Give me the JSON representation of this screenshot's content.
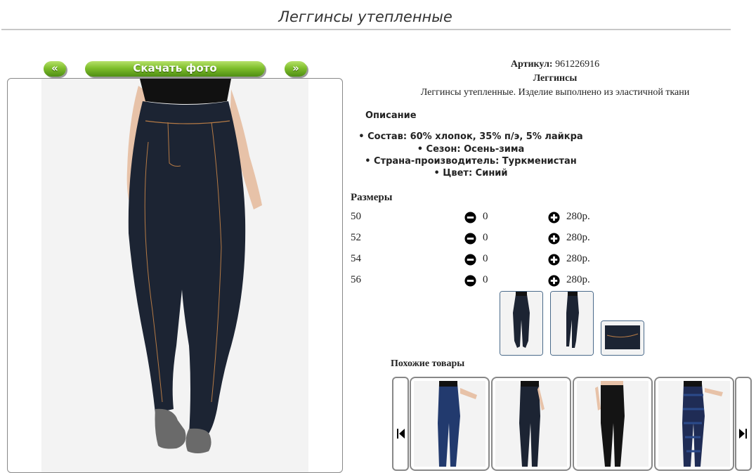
{
  "product": {
    "title": "Леггинсы утепленные",
    "article_label": "Артикул:",
    "article_value": "961226916",
    "name": "Леггинсы",
    "short_desc": "Леггинсы утепленные. Изделие выполнено из эластичной ткани"
  },
  "nav": {
    "prev_label": "«",
    "download_label": "Скачать фото",
    "next_label": "»"
  },
  "description": {
    "heading": "Описание",
    "items": [
      "• Состав: 60% хлопок, 35% п/э, 5% лайкра",
      "• Сезон: Осень-зима",
      "• Страна-производитель: Туркменистан",
      "• Цвет: Синий"
    ]
  },
  "sizes": {
    "heading": "Размеры",
    "rows": [
      {
        "size": "50",
        "qty": "0",
        "price": "280р."
      },
      {
        "size": "52",
        "qty": "0",
        "price": "280р."
      },
      {
        "size": "54",
        "qty": "0",
        "price": "280р."
      },
      {
        "size": "56",
        "qty": "0",
        "price": "280р."
      }
    ]
  },
  "similar": {
    "heading": "Похожие товары"
  },
  "colors": {
    "leggings": "#1c2433",
    "top": "#111111",
    "skin": "#e7c2a8",
    "shoe": "#6a6a6a",
    "stitch": "#b57a45",
    "accent_green": "#6fb22a"
  },
  "icons": {
    "minus": "minus-circle-icon",
    "plus": "plus-circle-icon",
    "carousel_prev": "skip-previous-icon",
    "carousel_next": "skip-next-icon"
  }
}
